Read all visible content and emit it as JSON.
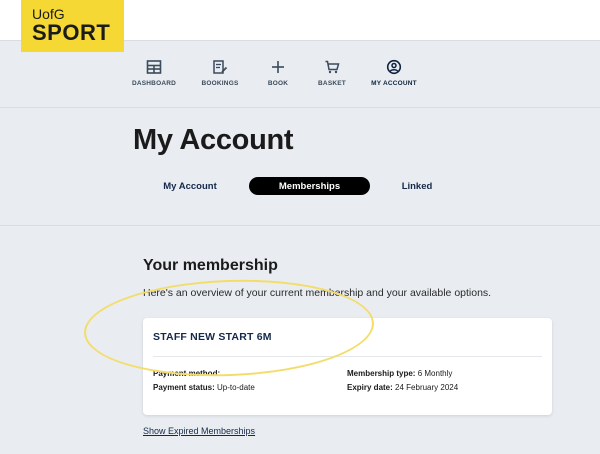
{
  "logo": {
    "line1": "UofG",
    "line2": "SPORT"
  },
  "nav": {
    "items": [
      {
        "label": "DASHBOARD",
        "icon": "dashboard-icon"
      },
      {
        "label": "BOOKINGS",
        "icon": "bookings-icon"
      },
      {
        "label": "BOOK",
        "icon": "plus-icon"
      },
      {
        "label": "BASKET",
        "icon": "cart-icon"
      },
      {
        "label": "MY ACCOUNT",
        "icon": "user-circle-icon"
      }
    ],
    "active": "MY ACCOUNT"
  },
  "page": {
    "title": "My Account"
  },
  "tabs": [
    {
      "label": "My Account"
    },
    {
      "label": "Memberships"
    },
    {
      "label": "Linked"
    }
  ],
  "membership": {
    "section_title": "Your membership",
    "section_subtitle": "Here's an overview of your current membership and your available options.",
    "card": {
      "title": "STAFF NEW START 6M",
      "payment_method_label": "Payment method:",
      "payment_method_value": "",
      "payment_status_label": "Payment status:",
      "payment_status_value": "Up-to-date",
      "membership_type_label": "Membership type:",
      "membership_type_value": "6 Monthly",
      "expiry_date_label": "Expiry date:",
      "expiry_date_value": "24 February 2024"
    },
    "expired_link": "Show Expired Memberships"
  },
  "colors": {
    "brand_yellow": "#f5d833",
    "navy": "#14284a",
    "background": "#e9edf1",
    "annotation": "#f3dd6a"
  }
}
